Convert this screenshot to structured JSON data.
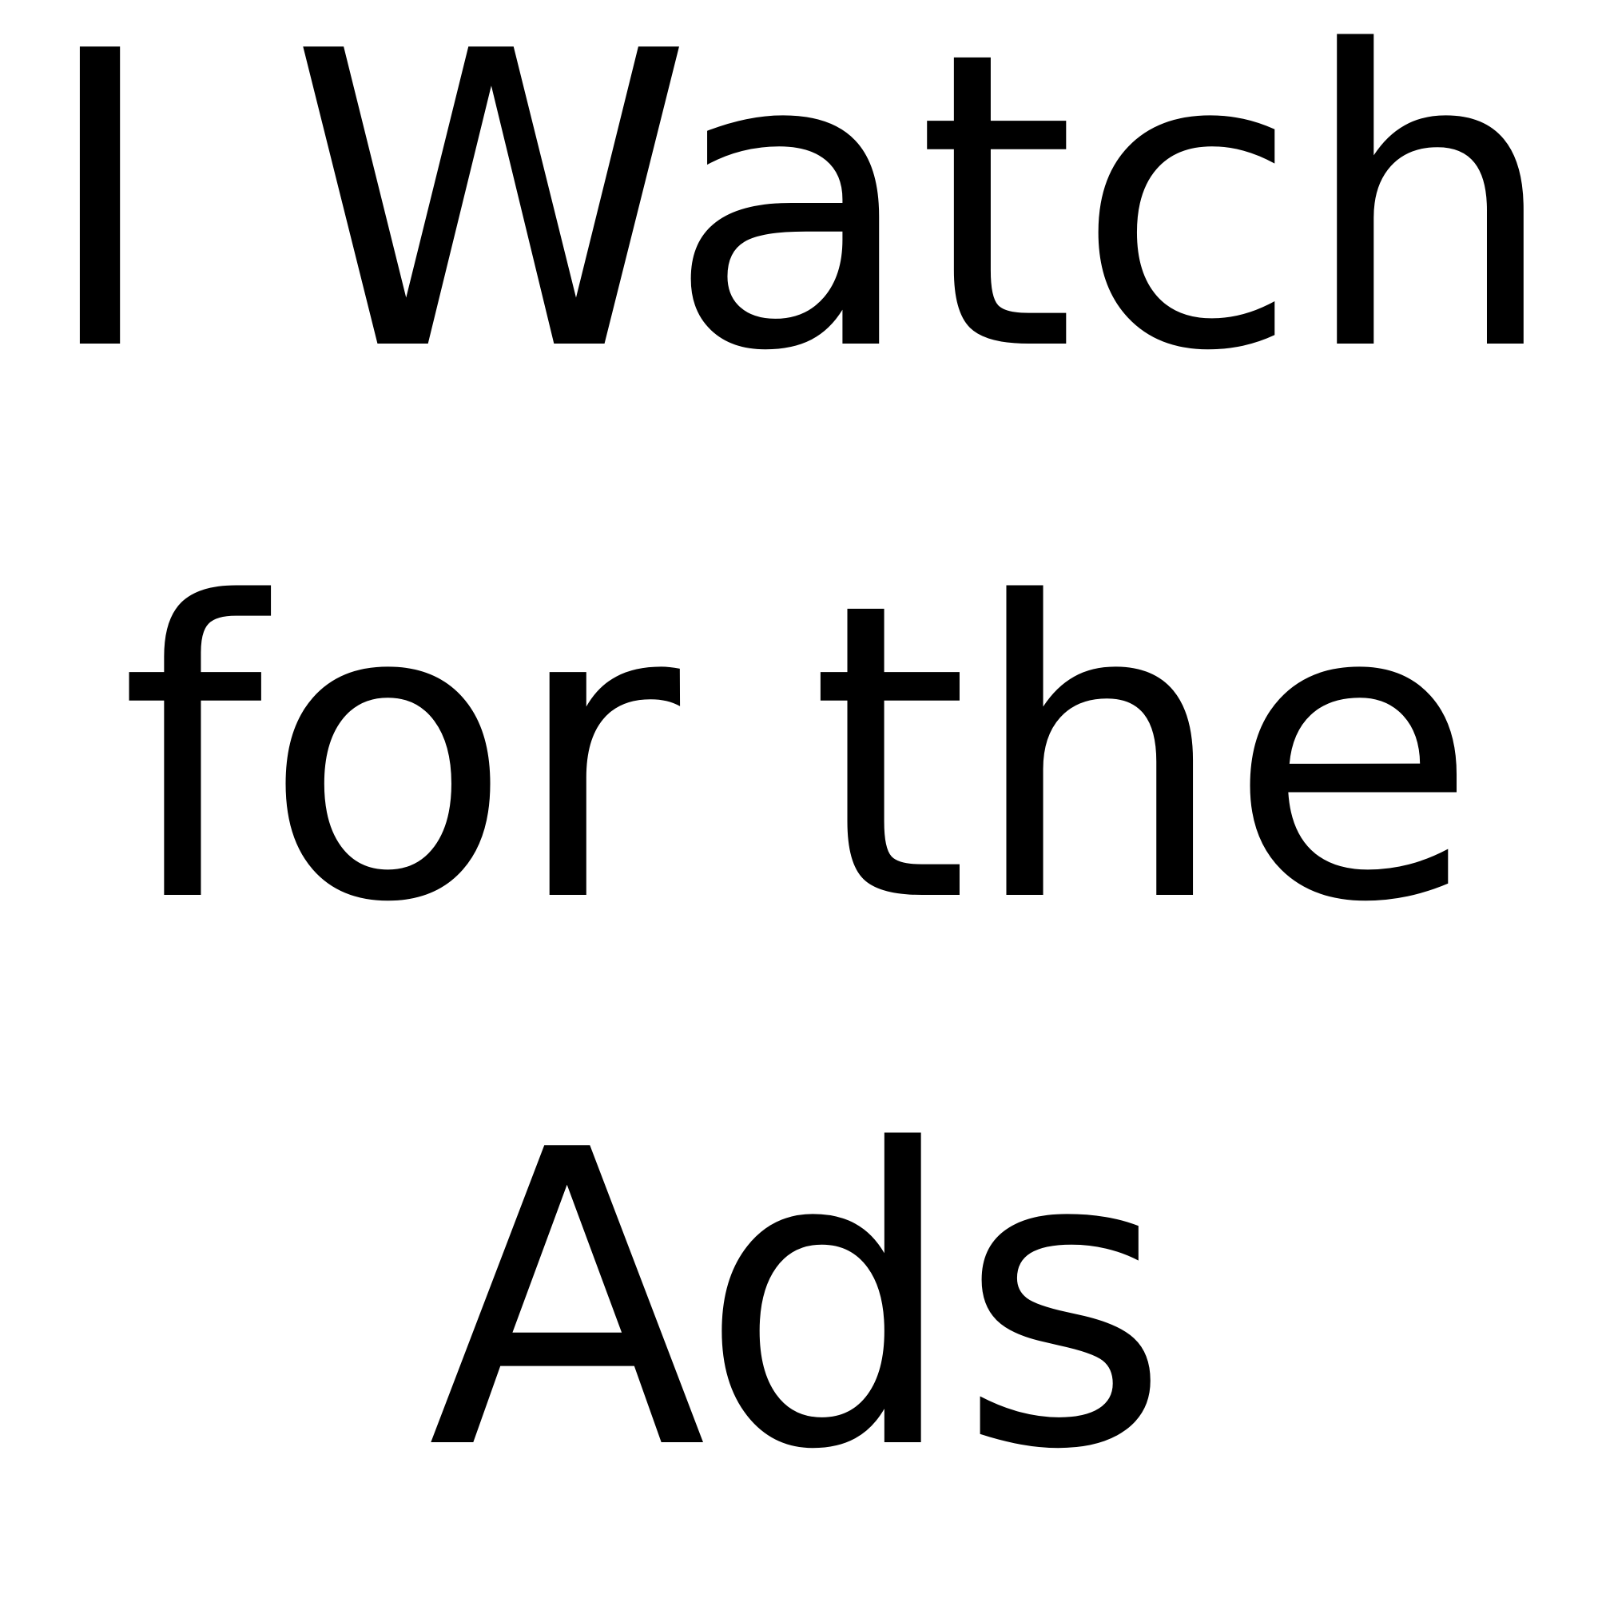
{
  "lines": [
    "I Watch",
    "for the",
    "Ads"
  ],
  "colors": {
    "background": "#ffffff",
    "text": "#000000"
  }
}
